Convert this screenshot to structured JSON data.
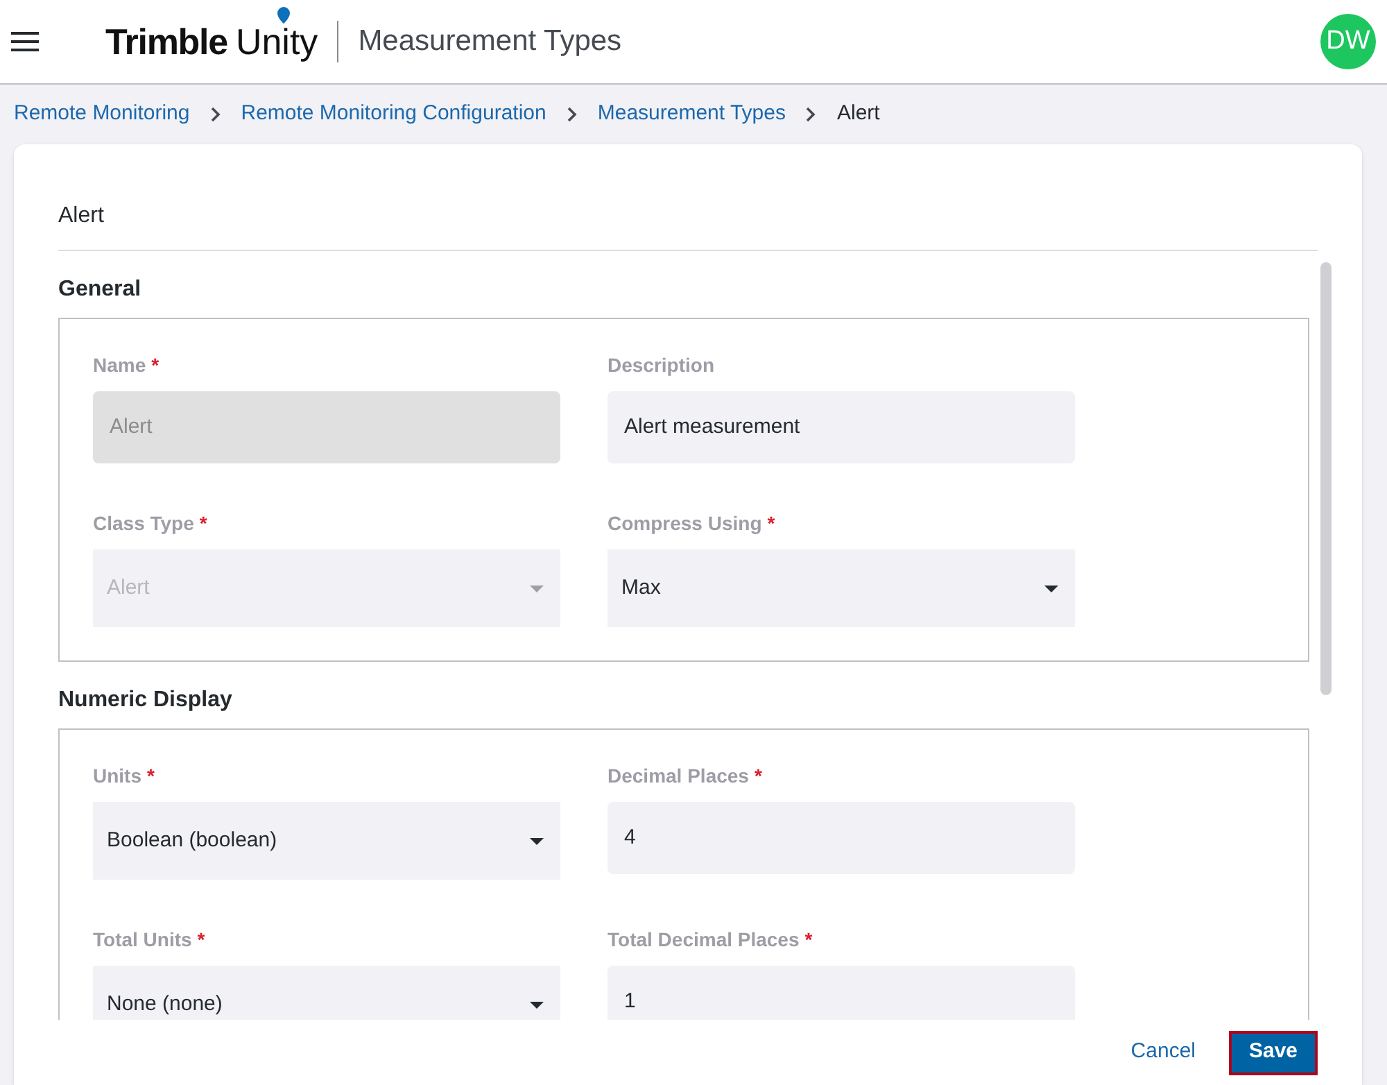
{
  "header": {
    "brand_bold": "Trimble",
    "brand_light": "Unity",
    "page_title": "Measurement Types",
    "avatar": "DW"
  },
  "breadcrumbs": [
    {
      "label": "Remote Monitoring",
      "link": true
    },
    {
      "label": "Remote Monitoring Configuration",
      "link": true
    },
    {
      "label": "Measurement Types",
      "link": true
    },
    {
      "label": "Alert",
      "link": false
    }
  ],
  "form": {
    "title": "Alert",
    "sections": [
      {
        "title": "General",
        "fields": [
          {
            "label": "Name",
            "required_mark": "*",
            "kind": "input",
            "disabled": true,
            "value": "Alert"
          },
          {
            "label": "Description",
            "kind": "input",
            "disabled": false,
            "value": "Alert measurement"
          },
          {
            "label": "Class Type",
            "required_mark": "*",
            "kind": "select",
            "disabled": true,
            "value": "Alert"
          },
          {
            "label": "Compress Using",
            "required_mark": "*",
            "kind": "select",
            "disabled": false,
            "value": "Max"
          }
        ]
      },
      {
        "title": "Numeric Display",
        "fields": [
          {
            "label": "Units",
            "required_mark": "*",
            "kind": "select",
            "disabled": false,
            "value": "Boolean (boolean)"
          },
          {
            "label": "Decimal Places",
            "required_mark": "*",
            "kind": "input",
            "disabled": false,
            "value": "4"
          },
          {
            "label": "Total Units",
            "required_mark": "*",
            "kind": "select",
            "disabled": false,
            "value": "None (none)"
          },
          {
            "label": "Total Decimal Places",
            "required_mark": "*",
            "kind": "input",
            "disabled": false,
            "value": "1"
          }
        ]
      }
    ]
  },
  "footer": {
    "cancel": "Cancel",
    "save": {
      "label": "Save",
      "focused": true
    }
  }
}
